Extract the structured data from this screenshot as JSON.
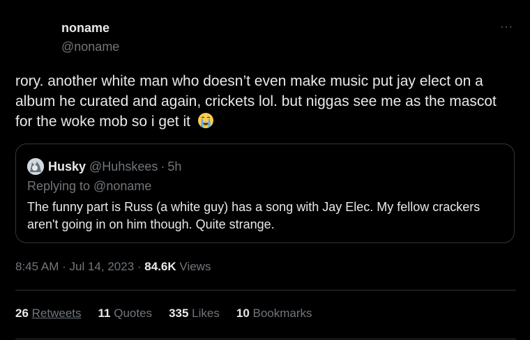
{
  "tweet": {
    "author_name": "noname",
    "author_handle": "@noname",
    "text": "rory. another white man who doesn’t even make music put jay elect on a album he curated and again, crickets lol. but niggas see me as the mascot for the woke mob so i get it",
    "emoji": "loudly-crying-face",
    "time": "8:45 AM",
    "date": "Jul 14, 2023",
    "views_count": "84.6K",
    "views_label": "Views"
  },
  "quote": {
    "name": "Husky",
    "handle": "@Huhskees",
    "time": "5h",
    "replying": "Replying to @noname",
    "text": "The funny part is Russ (a white guy) has a song with Jay Elec. My fellow crackers aren't going in on him though.  Quite strange."
  },
  "stats": {
    "retweets_count": "26",
    "retweets_label": "Retweets",
    "quotes_count": "11",
    "quotes_label": "Quotes",
    "likes_count": "335",
    "likes_label": "Likes",
    "bookmarks_count": "10",
    "bookmarks_label": "Bookmarks"
  },
  "more_glyph": "···",
  "separator": "·"
}
